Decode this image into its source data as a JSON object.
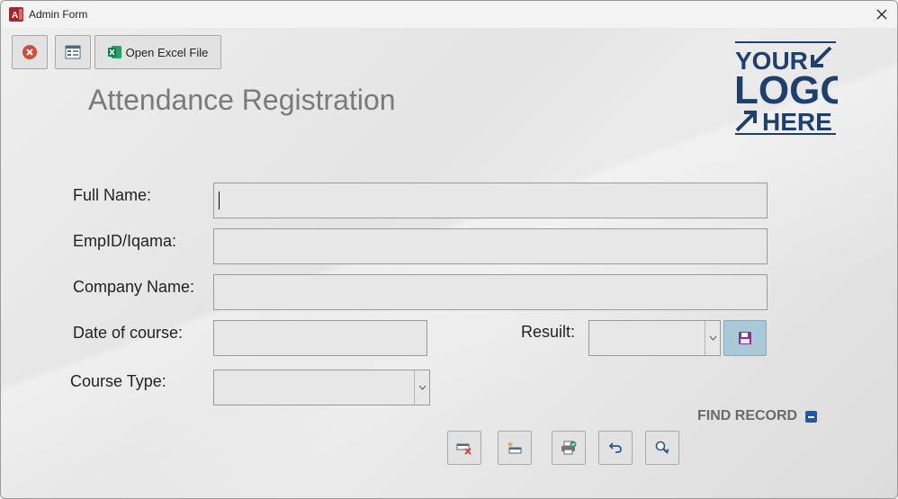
{
  "window": {
    "title": "Admin Form"
  },
  "toolbar": {
    "open_excel_label": "Open Excel File"
  },
  "header": {
    "title": "Attendance Registration"
  },
  "logo": {
    "line1": "YOUR",
    "line2": "LOGO",
    "line3": "HERE"
  },
  "form": {
    "full_name": {
      "label": "Full Name:",
      "value": ""
    },
    "emp_id": {
      "label": "EmpID/Iqama:",
      "value": ""
    },
    "company_name": {
      "label": "Company Name:",
      "value": ""
    },
    "date_of_course": {
      "label": "Date of course:",
      "value": ""
    },
    "result": {
      "label": "Resuilt:",
      "value": ""
    },
    "course_type": {
      "label": "Course Type:",
      "value": ""
    }
  },
  "find_record": {
    "label": "FIND RECORD"
  },
  "colors": {
    "logo": "#1f3f6e",
    "accent": "#1e5aa8",
    "save_button": "#a9c8d8"
  }
}
